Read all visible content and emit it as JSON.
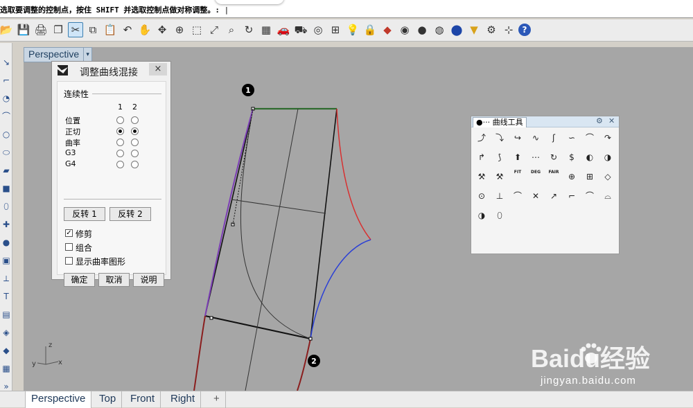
{
  "command_line": {
    "prompt": "选取要调整的控制点，按住 SHIFT 并选取控制点做对称调整。: "
  },
  "toolbar": {
    "icons": [
      "open-folder-icon",
      "save-icon",
      "print-icon",
      "copy-doc-icon",
      "cut-icon",
      "copy-icon",
      "paste-icon",
      "undo-icon",
      "pan-hand-icon",
      "move-icon",
      "zoom-icon",
      "zoom-window-icon",
      "zoom-extents-icon",
      "zoom-selected-icon",
      "rotate-view-icon",
      "four-viewports-icon",
      "car-icon",
      "shaded-car-icon",
      "circle-snap-icon",
      "cplane-icon",
      "light-bulb-icon",
      "lock-icon",
      "layer-icon",
      "color-wheel-icon",
      "sphere-shaded-icon",
      "sphere-rendered-icon",
      "sphere-blue-icon",
      "filter-icon",
      "gear-icon",
      "grid-snap-icon",
      "help-icon"
    ],
    "active_icon": "cut-icon"
  },
  "left_toolbar": {
    "icons": [
      "line-icon",
      "polyline-icon",
      "arc-icon",
      "curve-icon",
      "circle-icon",
      "ellipse-icon",
      "surface-icon",
      "box-icon",
      "cylinder-icon",
      "transform-icon",
      "boolean-icon",
      "mesh-icon",
      "dimension-icon",
      "text-icon",
      "group-icon",
      "block-icon",
      "render-icon",
      "grid-icon",
      "more-icon"
    ],
    "more_label": "»"
  },
  "viewport": {
    "title": "Perspective",
    "axes": {
      "x": "x",
      "y": "y",
      "z": "z"
    },
    "point_labels": [
      "1",
      "2"
    ]
  },
  "tabs": [
    "Perspective",
    "Top",
    "Front",
    "Right"
  ],
  "tab_add": "+",
  "dialog": {
    "title": "调整曲线混接",
    "close": "×",
    "group_label": "连续性",
    "col_headers": [
      "1",
      "2"
    ],
    "rows": [
      {
        "label": "位置",
        "sel1": false,
        "sel2": false
      },
      {
        "label": "正切",
        "sel1": true,
        "sel2": true
      },
      {
        "label": "曲率",
        "sel1": false,
        "sel2": false
      },
      {
        "label": "G3",
        "sel1": false,
        "sel2": false
      },
      {
        "label": "G4",
        "sel1": false,
        "sel2": false
      }
    ],
    "reverse_buttons": [
      "反转 1",
      "反转 2"
    ],
    "checkboxes": [
      {
        "label": "修剪",
        "checked": true
      },
      {
        "label": "组合",
        "checked": false
      },
      {
        "label": "显示曲率图形",
        "checked": false
      }
    ],
    "buttons": [
      "确定",
      "取消",
      "说明"
    ]
  },
  "curve_panel": {
    "title": "曲线工具",
    "tiny_labels": [
      "FIT",
      "DEG",
      "FAIR"
    ]
  },
  "watermark": {
    "brand": "Baidu经验",
    "url": "jingyan.baidu.com"
  }
}
